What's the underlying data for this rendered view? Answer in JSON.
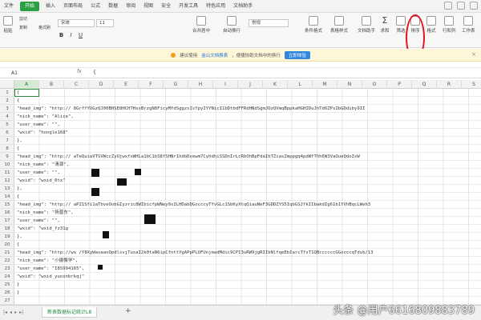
{
  "menu": {
    "items": [
      "文件",
      "开始",
      "插入",
      "页面布局",
      "公式",
      "数据",
      "审阅",
      "视图",
      "安全",
      "开发工具",
      "特色应用",
      "文档助手"
    ],
    "active_index": 1
  },
  "toolbar": {
    "paste": "粘贴",
    "cut": "剪切",
    "copy": "复制",
    "format_painter": "格式刷",
    "font_name": "宋体",
    "font_size": "11",
    "bold": "B",
    "italic": "I",
    "underline": "U",
    "merge_center": "合并居中",
    "auto_wrap": "自动换行",
    "number_format": "常规",
    "cond_format": "条件格式",
    "table_style": "表格样式",
    "doc_helper": "文档助手",
    "sum": "求和",
    "filter": "筛选",
    "sort": "排序",
    "format": "格式",
    "rows_cols": "行和列",
    "worksheet": "工作表"
  },
  "notice": {
    "text_before": "建议使用",
    "link": "金山文档换表",
    "text_after": "，便捷协助文档中的换行",
    "button": "立即体验"
  },
  "formula_bar": {
    "name_box": "A1",
    "fx": "fx",
    "content": "{"
  },
  "columns": [
    "A",
    "B",
    "C",
    "D",
    "E",
    "F",
    "G",
    "H",
    "I",
    "J",
    "K",
    "L",
    "M",
    "N",
    "O",
    "P",
    "Q",
    "R",
    "S"
  ],
  "rows": [
    "1",
    "2",
    "3",
    "4",
    "5",
    "6",
    "7",
    "8",
    "9",
    "10",
    "11",
    "12",
    "13",
    "14",
    "15",
    "16",
    "17",
    "18",
    "19",
    "20",
    "21",
    "22",
    "23",
    "24",
    "25",
    "26",
    "27"
  ],
  "cells": [
    "{",
    "  {",
    "    \"head_img\": \"http://                                   8GrffYUGzQJ00BHSE8HCH7HssBrzgN8FicyMfdSggzsIsYpyIYYNicI1bDtbdFFRdHNdSgmJOzQVmqBppkaHGHIDuJhTd6ZPsIbGDdiby9II",
    "    \"nick_name\": \"Alice\",",
    "    \"user_name\": \"\",",
    "    \"wxid\": \"hongle168\"",
    "  },",
    "  {",
    "    \"head_img\": \"http://                                   aTeQuiaVTSVWccZyUjwxfxWHLa1bC1bS8fSHNr1hdbDvewm7CyhdhiSSDnIrLcRbOhBpFdaIbTZiasZmppgq4pdWfThh6W3VaOueQdoZsW",
    "    \"nick_name\": \"清源\",",
    "    \"user_name\": \"\",",
    "    \"wxid\": \"wxid_0tx\"",
    "  },",
    "  {",
    "    \"head_img\": \"http://                                  aPZ1Sfi1aTbveOobGIyzric8WIbicfpWNey9xILHDabDGocccyTfvGLc1SbKyXtqQiauNeF3GDDZYS5IqbGSJfkIIbakdIg61b1YVhBqcLWeh3",
    "    \"nick_name\": \"扬晋东\",",
    "    \"user_name\": \"\",",
    "    \"wxid\": \"wxid_fz31g",
    "  },",
    "  {",
    "    \"head_img\": \"http://wx                      /Y8XyWavaanOpdlsvjTusaI2k0taN6ipCfnttYgAPpPLOFUnjmadMdic9CPI3uRW9jgRIIbNlfqeEbIarcTfsT1QBccccccGGocccqTdvb/13",
    "    \"nick_name\": \"小摄像学\",",
    "    \"user_name\": \"I8S994165\",",
    "    \"wxid\": \"wxid_yuosnbrkqj\"",
    "  }",
    "}"
  ],
  "sheet": {
    "tab_label": "新表数据标记统计L8",
    "add_label": "+"
  },
  "watermark": "头条 @用户6616809883789",
  "colors": {
    "accent_green": "#2aa044",
    "highlight_red": "#e0141e",
    "notice_bg": "#fff6d9"
  }
}
